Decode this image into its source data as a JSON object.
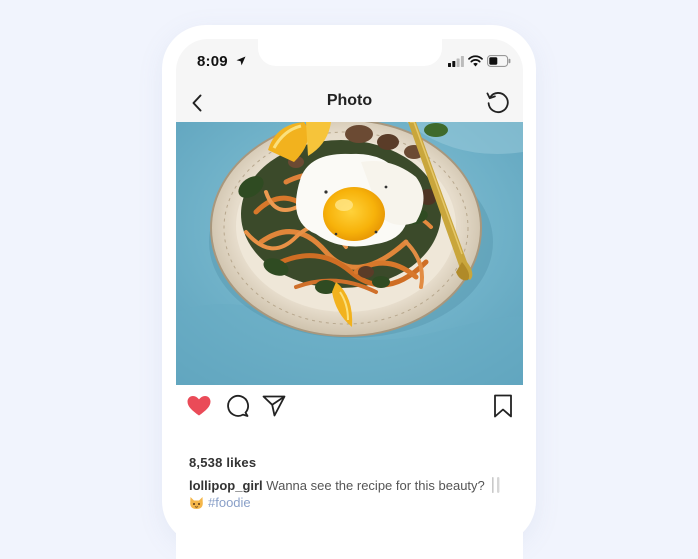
{
  "status_bar": {
    "time": "8:09"
  },
  "nav": {
    "title": "Photo",
    "back_icon": "chevron-left-icon",
    "right_icon": "refresh-icon"
  },
  "post": {
    "image_description_icon": "food-photo",
    "likes": "8,538 likes",
    "username": "lollipop_girl",
    "caption": "Wanna see the recipe for this beauty?",
    "hashtag": "#foodie",
    "icons": [
      "heart-icon",
      "comment-icon",
      "share-icon",
      "bookmark-icon"
    ]
  },
  "colors": {
    "background": "#f1f4fd",
    "heart": "#ea4b58",
    "hashtag": "#8aa0c8",
    "nav_bar": "#f6f6f6"
  }
}
